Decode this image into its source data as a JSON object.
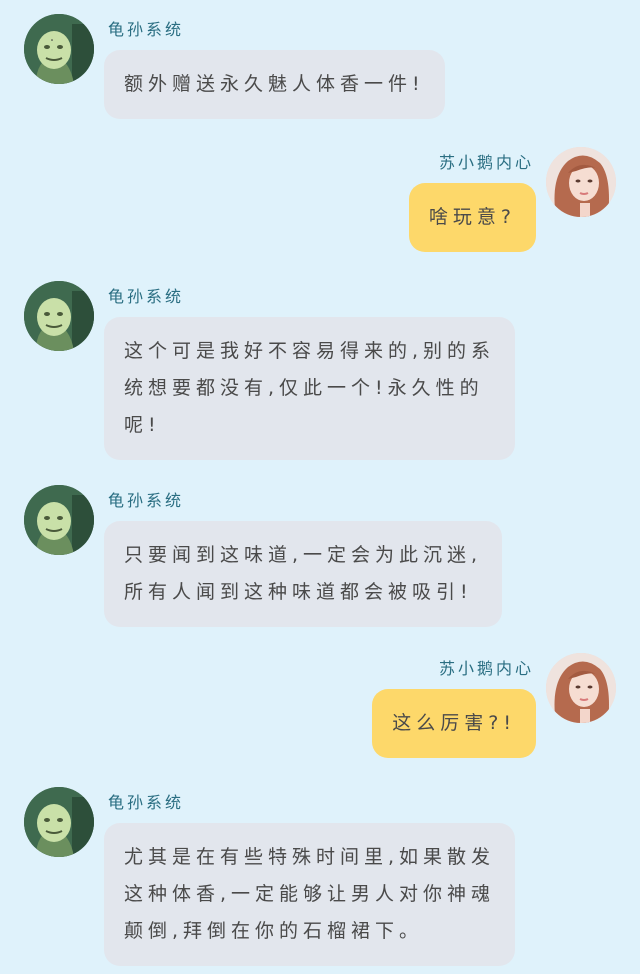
{
  "contacts": {
    "system": {
      "name": "龟孙系统",
      "avatar_icon": "meme-face-avatar"
    },
    "user": {
      "name": "苏小鹅内心",
      "avatar_icon": "girl-photo-avatar"
    }
  },
  "colors": {
    "background": "#dff2fb",
    "system_bubble": "#e2e6ed",
    "user_bubble": "#fdd86a",
    "name_text": "#2a6e82",
    "message_text": "#4a4a4a"
  },
  "messages": [
    {
      "sender": "system",
      "name": "龟孙系统",
      "lines": [
        "额外赠送永久魅人体香一件!"
      ]
    },
    {
      "sender": "user",
      "name": "苏小鹅内心",
      "lines": [
        "啥玩意?"
      ]
    },
    {
      "sender": "system",
      "name": "龟孙系统",
      "lines": [
        "这个可是我好不容易得来的,别的系",
        "统想要都没有,仅此一个!永久性的",
        "呢!"
      ]
    },
    {
      "sender": "system",
      "name": "龟孙系统",
      "lines": [
        "只要闻到这味道,一定会为此沉迷,",
        "所有人闻到这种味道都会被吸引!"
      ]
    },
    {
      "sender": "user",
      "name": "苏小鹅内心",
      "lines": [
        "这么厉害?!"
      ]
    },
    {
      "sender": "system",
      "name": "龟孙系统",
      "lines": [
        "尤其是在有些特殊时间里,如果散发",
        "这种体香,一定能够让男人对你神魂",
        "颠倒,拜倒在你的石榴裙下。"
      ]
    }
  ]
}
